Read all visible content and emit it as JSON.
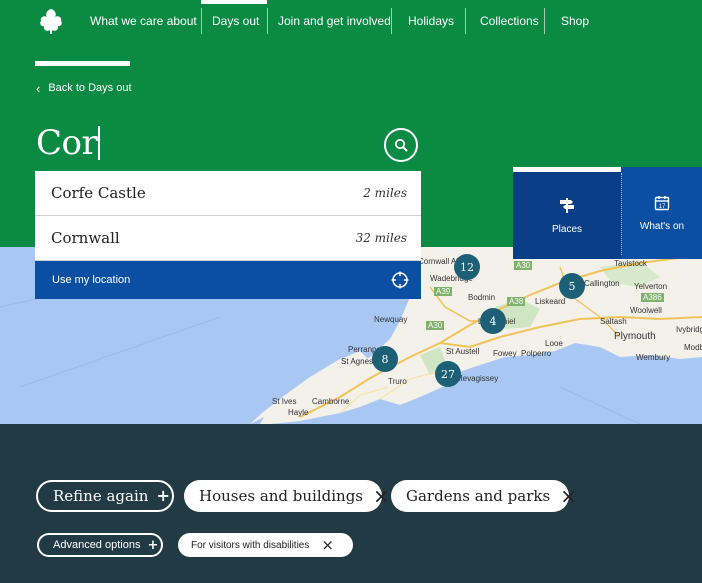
{
  "nav": {
    "items": [
      {
        "label": "What we care about"
      },
      {
        "label": "Days out"
      },
      {
        "label": "Join and get involved"
      },
      {
        "label": "Holidays"
      },
      {
        "label": "Collections"
      },
      {
        "label": "Shop"
      }
    ],
    "active": "Days out"
  },
  "back_link": "Back to Days out",
  "search": {
    "value": "Cor"
  },
  "suggestions": [
    {
      "name": "Corfe Castle",
      "distance": "2 miles"
    },
    {
      "name": "Cornwall",
      "distance": "32 miles"
    }
  ],
  "use_location": "Use my location",
  "tabs": {
    "places": "Places",
    "whats_on": "What's on"
  },
  "map": {
    "labels": [
      "Tavistock",
      "Wadebridge",
      "Bodmin",
      "Liskeard",
      "Yelverton",
      "Newquay",
      "Saltash",
      "Woolwell",
      "Plymouth",
      "Perranporth",
      "St Agnes",
      "St Austell",
      "Fowey",
      "Polperro",
      "Looe",
      "Wembury",
      "Ivybridge",
      "Truro",
      "Mevagissey",
      "St Ives",
      "Camborne",
      "Hayle",
      "Modbury",
      "Lostwithiel",
      "Cornwall Airport",
      "Callington"
    ],
    "road_labels": [
      "A30",
      "A38",
      "A39",
      "A390",
      "A386",
      "A30"
    ],
    "clusters": [
      "12",
      "5",
      "4",
      "8",
      "27"
    ]
  },
  "filters": {
    "refine": "Refine again",
    "chips": [
      "Houses and buildings",
      "Gardens and parks"
    ],
    "advanced": "Advanced options",
    "small_chip": "For visitors with disabilities"
  },
  "colors": {
    "brand_green": "#0b8a43",
    "tab_blue": "#0b4fa2",
    "footer_dark": "#223a44",
    "cluster": "#1d5f74"
  }
}
